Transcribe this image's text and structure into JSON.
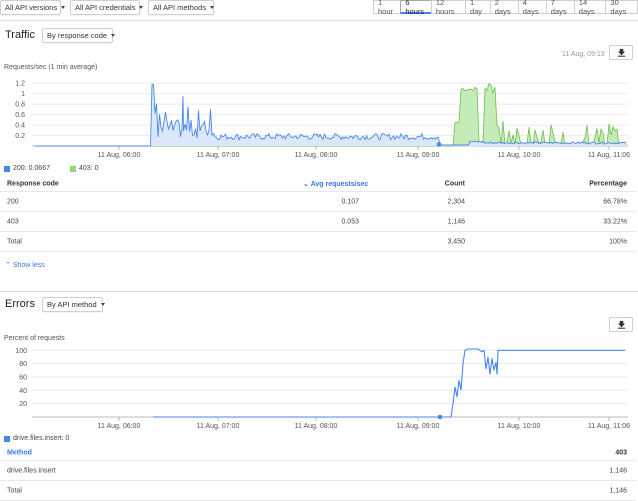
{
  "filters": {
    "versions": "All API versions",
    "credentials": "All API credentials",
    "methods": "All API methods"
  },
  "time_ranges": [
    "1 hour",
    "6 hours",
    "12 hours",
    "1 day",
    "2 days",
    "4 days",
    "7 days",
    "14 days",
    "30 days"
  ],
  "time_selected": "6 hours",
  "traffic": {
    "title": "Traffic",
    "group_by": "By response code",
    "timestamp": "11 Aug, 09:13",
    "y_label": "Requests/sec (1 min average)",
    "y_ticks": [
      "1.2",
      "1",
      "0.8",
      "0.6",
      "0.4",
      "0.2"
    ],
    "x_ticks": [
      "11 Aug, 06:00",
      "11 Aug, 07:00",
      "11 Aug, 08:00",
      "11 Aug, 09:00",
      "11 Aug, 10:00",
      "11 Aug, 11:06"
    ],
    "legend": [
      {
        "label": "200: 0.0667",
        "color": "#4a86e8"
      },
      {
        "label": "403: 0",
        "color": "#93d67d"
      }
    ],
    "table": {
      "headers": {
        "code": "Response code",
        "avg": "Avg requests/sec",
        "count": "Count",
        "pct": "Percentage"
      },
      "rows": [
        {
          "code": "200",
          "avg": "0.107",
          "count": "2,304",
          "pct": "66.78%"
        },
        {
          "code": "403",
          "avg": "0.053",
          "count": "1,146",
          "pct": "33.22%"
        }
      ],
      "total": {
        "label": "Total",
        "count": "3,450",
        "pct": "100%"
      }
    },
    "show_less": "Show less"
  },
  "errors": {
    "title": "Errors",
    "group_by": "By API method",
    "y_label": "Percent of requests",
    "y_ticks": [
      "100",
      "80",
      "60",
      "40",
      "20"
    ],
    "x_ticks": [
      "11 Aug, 06:00",
      "11 Aug, 07:00",
      "11 Aug, 08:00",
      "11 Aug, 09:00",
      "11 Aug, 10:00",
      "11 Aug, 11:06"
    ],
    "legend": [
      {
        "label": "drive.files.insert: 0",
        "color": "#4a86e8"
      }
    ],
    "table": {
      "headers": {
        "method": "Method",
        "code": "403"
      },
      "rows": [
        {
          "method": "drive.files.insert",
          "value": "1,146"
        }
      ],
      "total": {
        "label": "Total",
        "value": "1,146"
      }
    }
  },
  "colors": {
    "blue": "#4a86e8",
    "green": "#93d67d",
    "accent": "#4285f4"
  }
}
